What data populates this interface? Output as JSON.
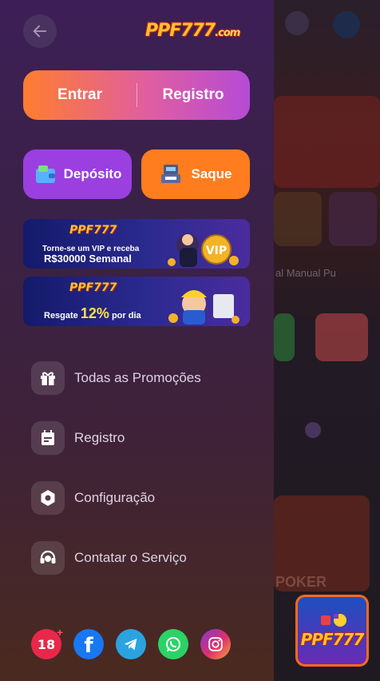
{
  "header": {
    "logo_text": "PPF777",
    "logo_suffix": ".com"
  },
  "auth": {
    "login_label": "Entrar",
    "register_label": "Registro"
  },
  "wallet": {
    "deposit_label": "Depósito",
    "withdraw_label": "Saque"
  },
  "banners": [
    {
      "logo": "PPF777",
      "line1": "Torne-se um VIP e receba",
      "line2": "R$30000 Semanal",
      "badge": "VIP"
    },
    {
      "logo": "PPF777",
      "prefix": "Resgate",
      "percent": "12%",
      "suffix": "por dia"
    }
  ],
  "menu": [
    {
      "label": "Todas as Promoções",
      "icon": "gift-icon"
    },
    {
      "label": "Registro",
      "icon": "calendar-icon"
    },
    {
      "label": "Configuração",
      "icon": "settings-icon"
    },
    {
      "label": "Contatar o Serviço",
      "icon": "headset-icon"
    }
  ],
  "social": [
    {
      "name": "age-18",
      "text": "18"
    },
    {
      "name": "facebook",
      "text": "f"
    },
    {
      "name": "telegram",
      "text": ""
    },
    {
      "name": "whatsapp",
      "text": ""
    },
    {
      "name": "instagram",
      "text": ""
    }
  ],
  "background": {
    "label": "al Manual Pu",
    "poker_text": "POKER"
  },
  "fab": {
    "logo": "PPF777"
  },
  "colors": {
    "accent_orange": "#ff7d1f",
    "accent_purple": "#9b3fe0",
    "drawer_bg": "#3d1f57"
  }
}
